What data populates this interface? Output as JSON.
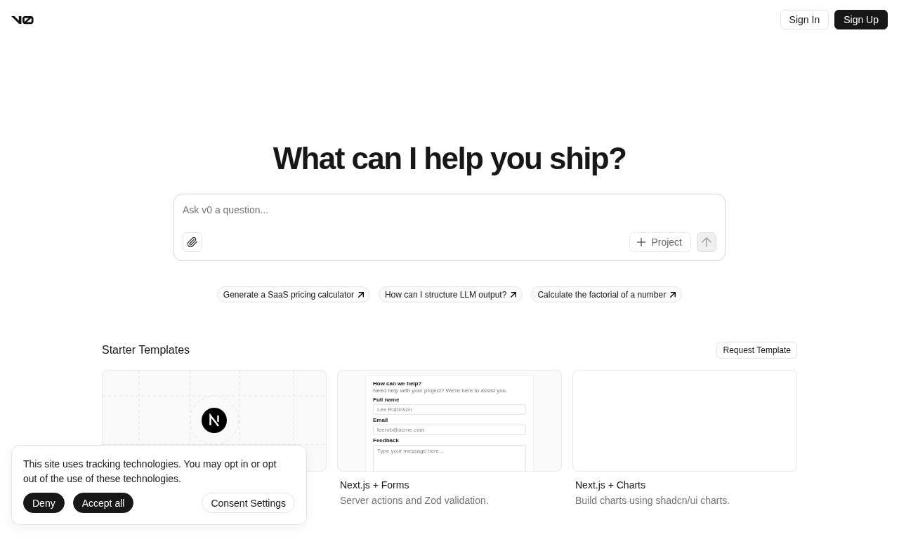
{
  "header": {
    "buttons": [
      {
        "label": "Sign In",
        "kind": "outline"
      },
      {
        "label": "Sign Up",
        "kind": "solid"
      }
    ]
  },
  "heading": "What can I help you ship?",
  "prompt": {
    "placeholder": "Ask v0 a question...",
    "project_button": "Project",
    "send_button": {
      "disabled": true
    }
  },
  "suggestions": [
    "Generate a SaaS pricing calculator",
    "How can I structure LLM output?",
    "Calculate the factorial of a number"
  ],
  "templates": {
    "title": "Starter Templates",
    "request_button": "Request Template",
    "cards": [
      {
        "kind": "logo"
      },
      {
        "kind": "form",
        "title": "Next.js + Forms",
        "description": "Server actions and Zod validation.",
        "form": {
          "heading": "How can we help?",
          "subheading": "Need help with your project? We're here to assist you.",
          "fields": [
            {
              "kind": "input",
              "label": "Full name",
              "placeholder": "Lee Robinson"
            },
            {
              "kind": "input",
              "label": "Email",
              "placeholder": "leerob@acme.com"
            },
            {
              "kind": "textarea",
              "label": "Feedback",
              "placeholder": "Type your message here..."
            }
          ]
        }
      },
      {
        "kind": "blank",
        "title": "Next.js + Charts",
        "description": "Build charts using shadcn/ui charts."
      }
    ]
  },
  "cookie_banner": {
    "text": "This site uses tracking technologies. You may opt in or opt out of the use of these technologies.",
    "buttons": [
      {
        "label": "Deny",
        "kind": "solid"
      },
      {
        "label": "Accept all",
        "kind": "solid"
      },
      {
        "label": "Consent Settings",
        "kind": "outline"
      }
    ]
  }
}
